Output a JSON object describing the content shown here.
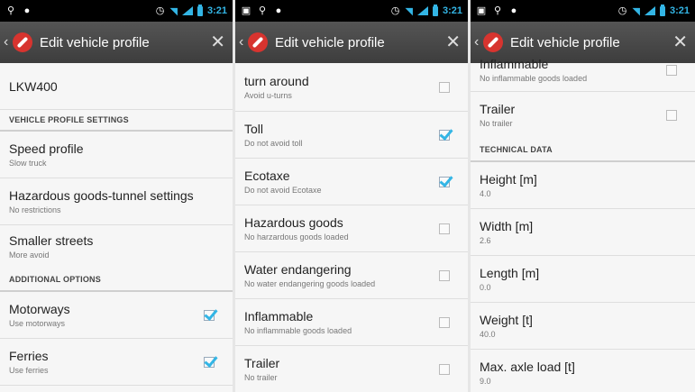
{
  "status_bar": {
    "time": "3:21"
  },
  "action_bar": {
    "title": "Edit vehicle profile",
    "close_glyph": "✕",
    "back_glyph": "‹"
  },
  "screen1": {
    "profile_name": "LKW400",
    "section_vehicle": "VEHICLE PROFILE SETTINGS",
    "speed_profile": {
      "title": "Speed profile",
      "sub": "Slow truck"
    },
    "tunnel": {
      "title": "Hazardous goods-tunnel settings",
      "sub": "No restrictions"
    },
    "smaller_streets": {
      "title": "Smaller streets",
      "sub": "More avoid"
    },
    "section_additional": "ADDITIONAL OPTIONS",
    "motorways": {
      "title": "Motorways",
      "sub": "Use motorways",
      "checked": true
    },
    "ferries": {
      "title": "Ferries",
      "sub": "Use ferries",
      "checked": true
    }
  },
  "screen2": {
    "turn_around": {
      "title": "turn around",
      "sub": "Avoid u-turns",
      "checked": false
    },
    "toll": {
      "title": "Toll",
      "sub": "Do not avoid toll",
      "checked": true
    },
    "ecotaxe": {
      "title": "Ecotaxe",
      "sub": "Do not avoid Ecotaxe",
      "checked": true
    },
    "hazardous": {
      "title": "Hazardous goods",
      "sub": "No harzardous goods loaded",
      "checked": false
    },
    "water": {
      "title": "Water endangering",
      "sub": "No water endangering goods loaded",
      "checked": false
    },
    "inflammable": {
      "title": "Inflammable",
      "sub": "No inflammable goods loaded",
      "checked": false
    },
    "trailer": {
      "title": "Trailer",
      "sub": "No trailer",
      "checked": false
    }
  },
  "screen3": {
    "inflammable": {
      "title": "Inflammable",
      "sub": "No inflammable goods loaded",
      "checked": false
    },
    "trailer": {
      "title": "Trailer",
      "sub": "No trailer",
      "checked": false
    },
    "section_technical": "TECHNICAL DATA",
    "height": {
      "title": "Height [m]",
      "value": "4.0"
    },
    "width": {
      "title": "Width [m]",
      "value": "2.6"
    },
    "length": {
      "title": "Length [m]",
      "value": "0.0"
    },
    "weight": {
      "title": "Weight [t]",
      "value": "40.0"
    },
    "axle": {
      "title": "Max. axle load [t]",
      "value": "9.0"
    }
  }
}
